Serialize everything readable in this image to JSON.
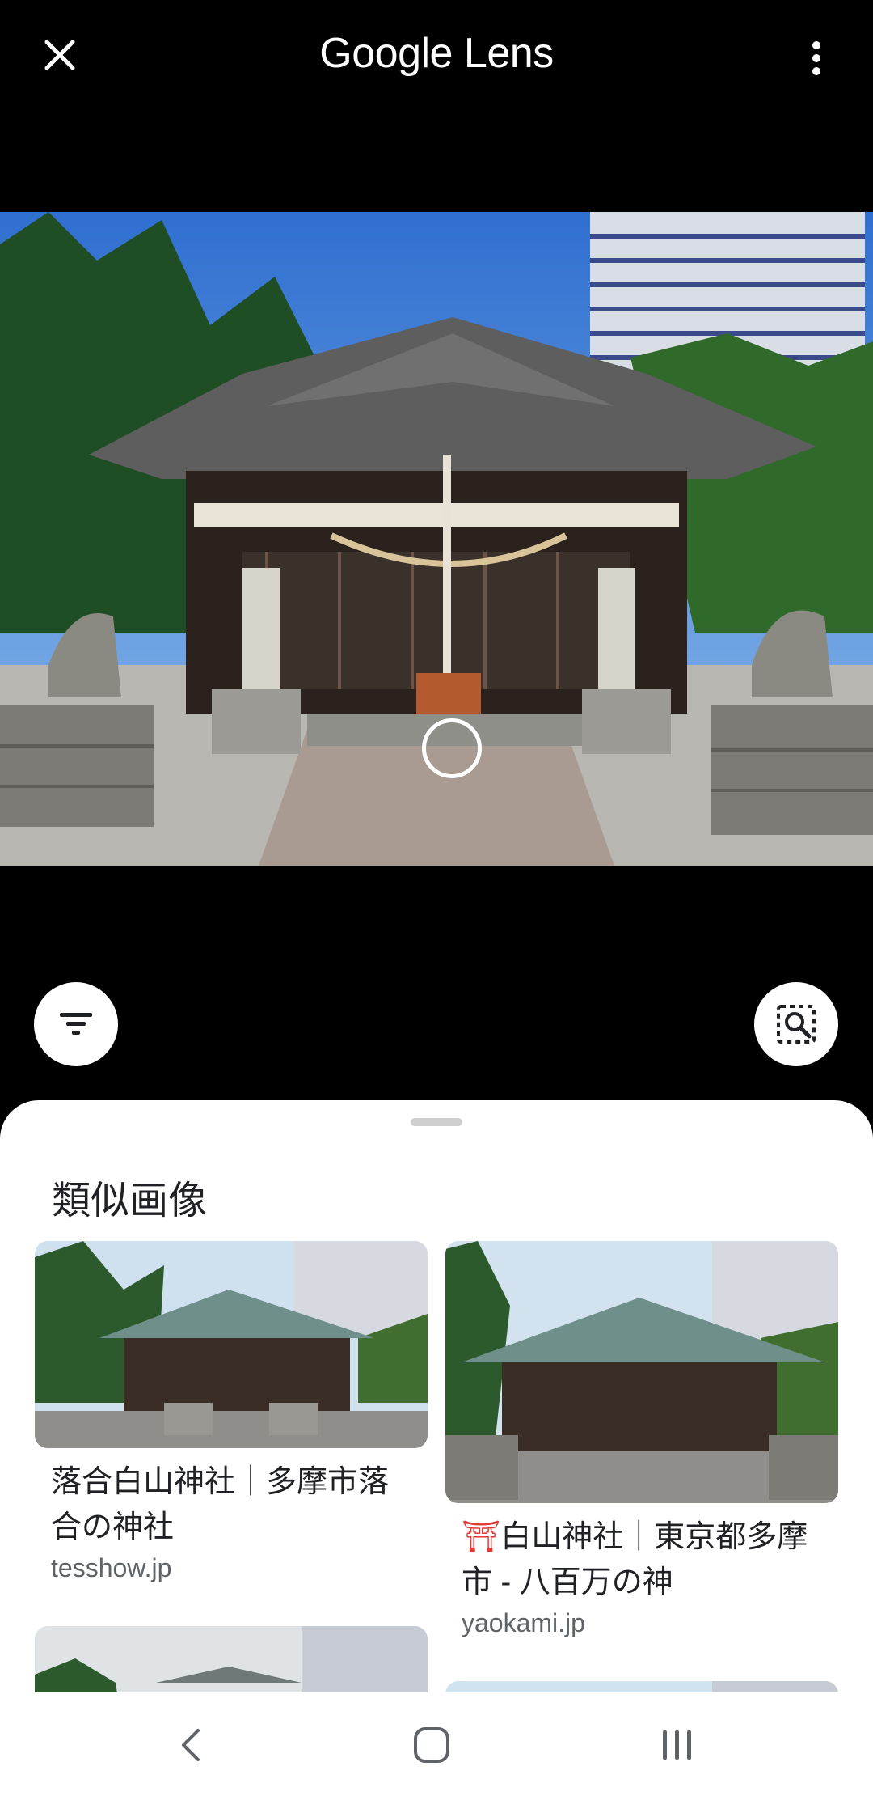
{
  "app": {
    "title_brand": "Google",
    "title_product": " Lens",
    "close_icon": "close-icon",
    "menu_icon": "more-vert-icon"
  },
  "photo": {
    "subject": "shrine-photo"
  },
  "actions": {
    "filter_icon": "filter-icon",
    "image_search_icon": "image-search-icon"
  },
  "sheet": {
    "title": "類似画像",
    "results": [
      {
        "title": "落合白山神社｜多摩市落合の神社",
        "source": "tesshow.jp"
      },
      {
        "title_icon": "⛩",
        "title": "白山神社｜東京都多摩市 - 八百万の神",
        "source": "yaokami.jp"
      }
    ]
  },
  "navbar": {
    "back_icon": "back-icon",
    "home_icon": "home-icon",
    "recents_icon": "recents-icon"
  },
  "colors": {
    "background": "#000000",
    "sheet": "#ffffff",
    "text_primary": "#202124",
    "text_secondary": "#5f6368"
  }
}
